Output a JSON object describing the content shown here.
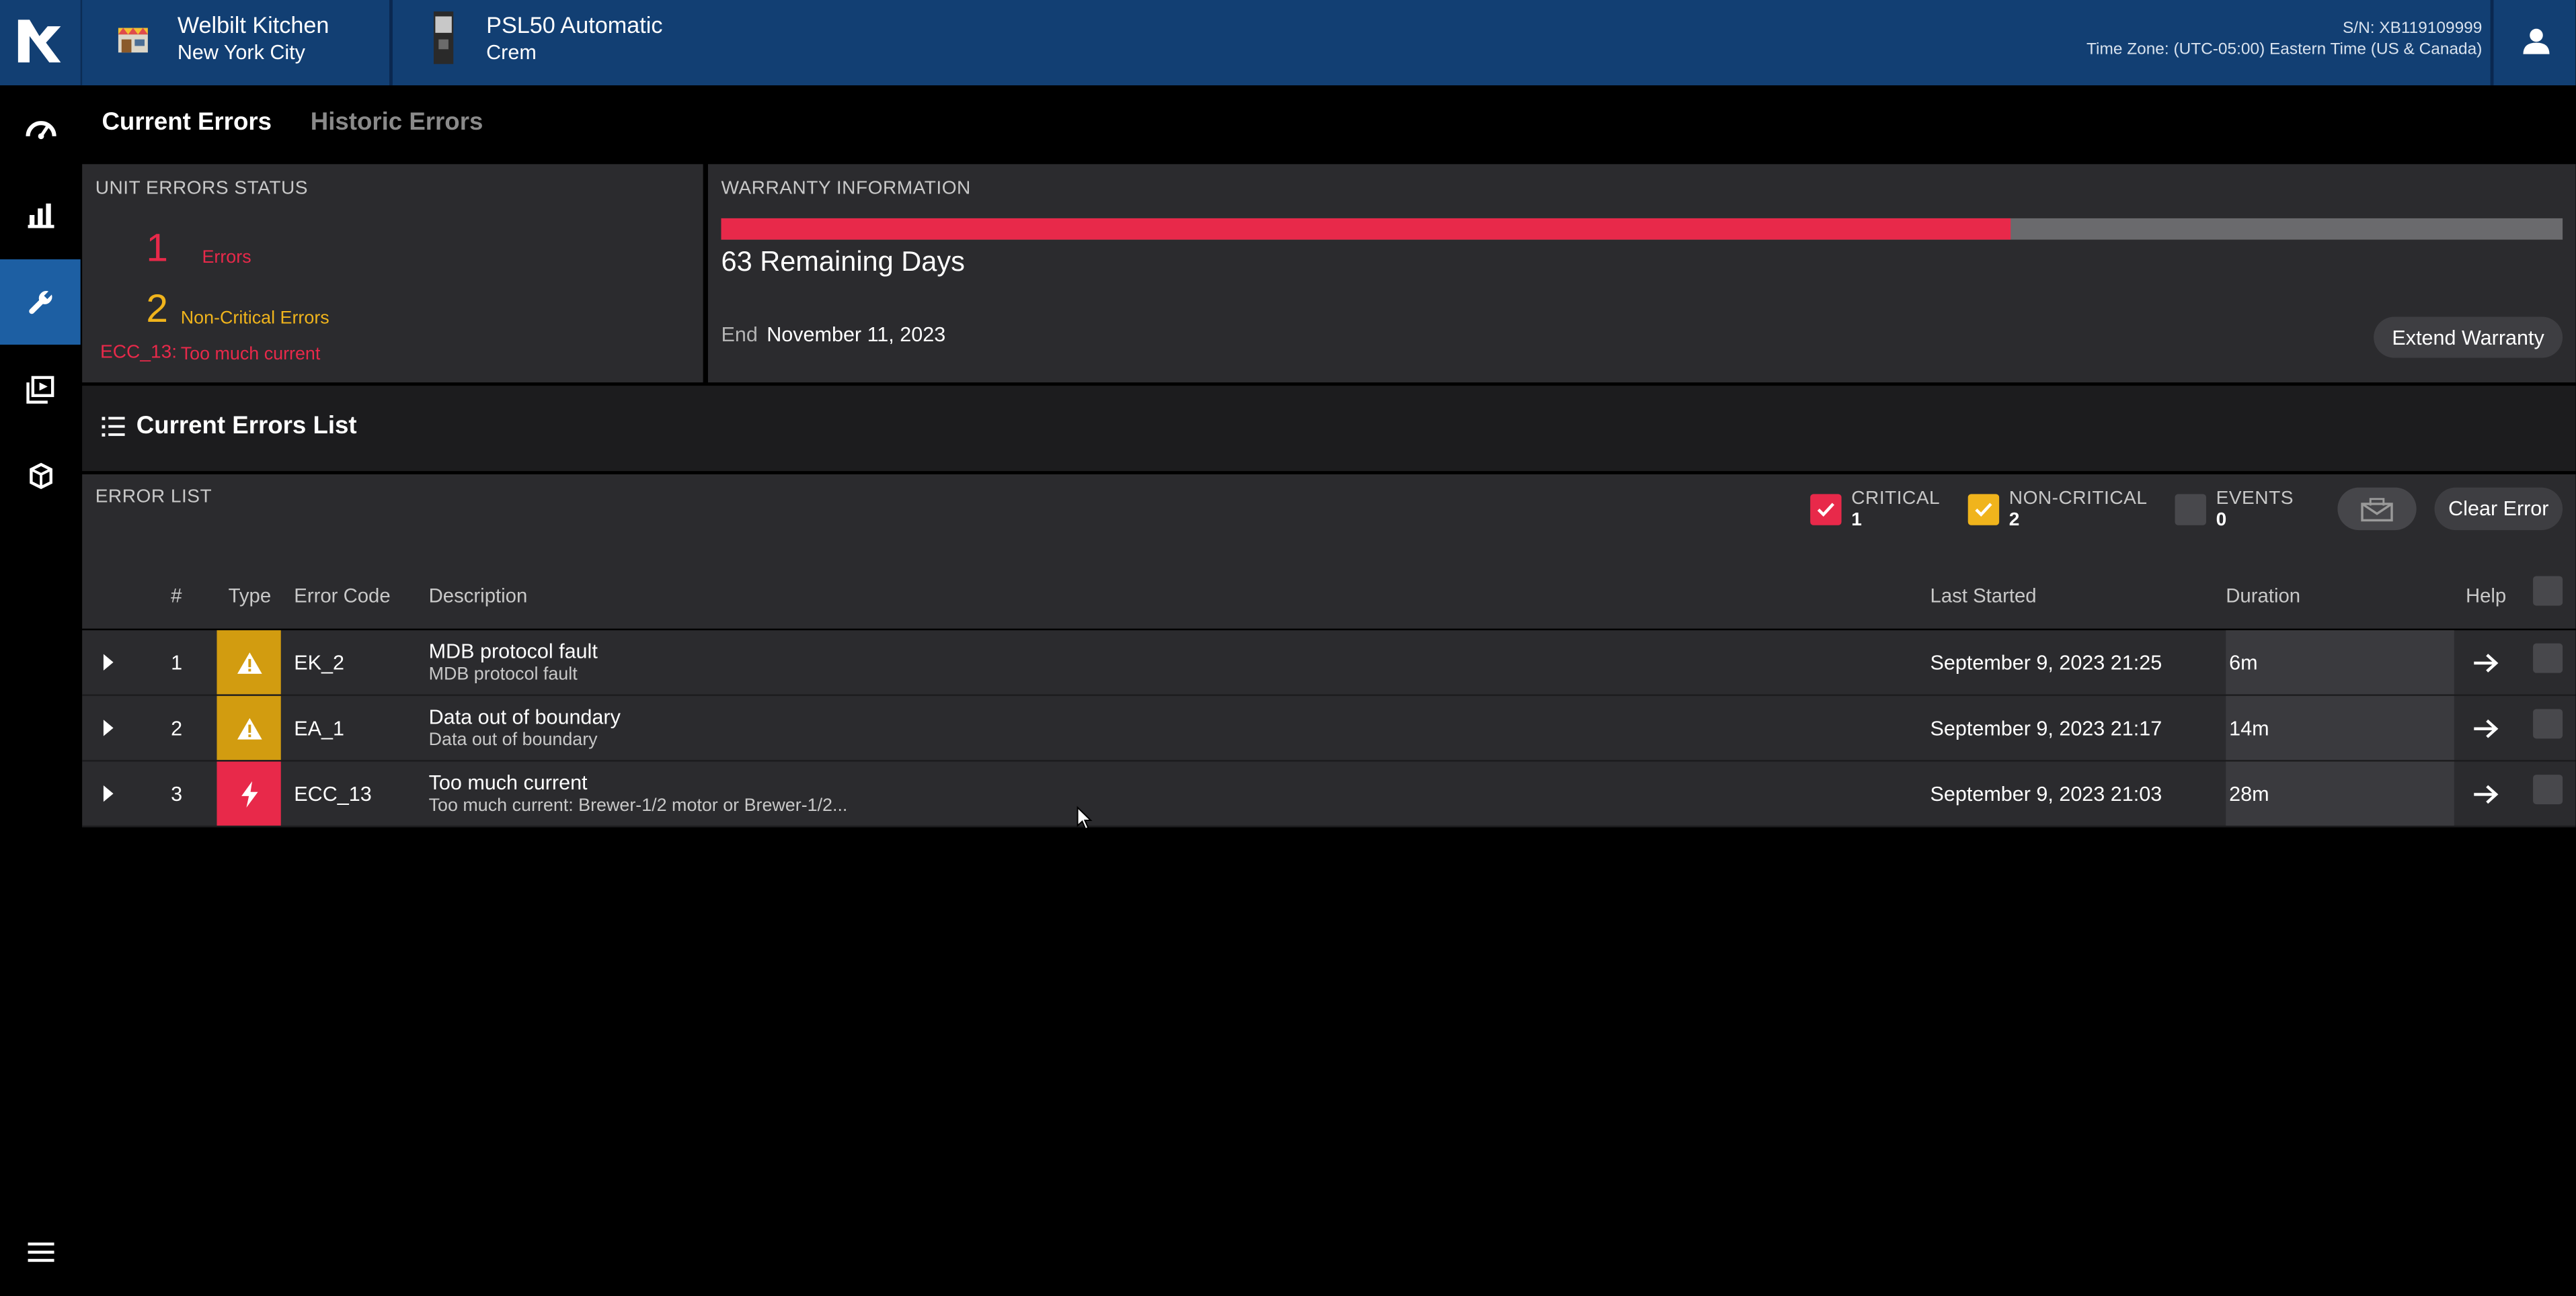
{
  "header": {
    "location_name": "Welbilt Kitchen",
    "location_city": "New York City",
    "unit_model": "PSL50 Automatic",
    "unit_brand": "Crem",
    "serial": "S/N: XB119109999",
    "timezone": "Time Zone: (UTC-05:00) Eastern Time (US & Canada)"
  },
  "tabs": [
    {
      "label": "Current Errors",
      "active": true
    },
    {
      "label": "Historic Errors",
      "active": false
    }
  ],
  "sidebar": {
    "items": [
      {
        "icon": "dashboard-gauge-icon"
      },
      {
        "icon": "bar-chart-icon"
      },
      {
        "icon": "wrench-icon",
        "active": true
      },
      {
        "icon": "media-library-icon"
      },
      {
        "icon": "package-box-icon"
      }
    ],
    "menu_icon": "hamburger-menu-icon"
  },
  "status": {
    "title": "UNIT ERRORS STATUS",
    "errors_count": "1",
    "errors_label": "Errors",
    "noncritical_count": "2",
    "noncritical_label": "Non-Critical Errors",
    "latest_code": "ECC_13:",
    "latest_desc": "Too much current"
  },
  "warranty": {
    "title": "WARRANTY INFORMATION",
    "progress_fraction": 0.7,
    "remaining": "63 Remaining Days",
    "end_label": "End",
    "end_date": "November 11, 2023",
    "extend_label": "Extend Warranty"
  },
  "list_section": {
    "title": "Current Errors List",
    "error_list_label": "ERROR LIST",
    "filters": [
      {
        "label": "CRITICAL",
        "count": "1",
        "checked": true,
        "color": "#e8294a"
      },
      {
        "label": "NON-CRITICAL",
        "count": "2",
        "checked": true,
        "color": "#f0b41c"
      },
      {
        "label": "EVENTS",
        "count": "0",
        "checked": false,
        "color": "#48484c"
      }
    ],
    "clear_label": "Clear Error"
  },
  "table": {
    "columns": {
      "num": "#",
      "type": "Type",
      "code": "Error Code",
      "desc": "Description",
      "started": "Last Started",
      "duration": "Duration",
      "help": "Help"
    },
    "rows": [
      {
        "num": "1",
        "type": "warning",
        "code": "EK_2",
        "title": "MDB protocol fault",
        "detail": "MDB protocol fault",
        "started": "September 9, 2023 21:25",
        "duration": "6m"
      },
      {
        "num": "2",
        "type": "warning",
        "code": "EA_1",
        "title": "Data out of boundary",
        "detail": "Data out of boundary",
        "started": "September 9, 2023 21:17",
        "duration": "14m"
      },
      {
        "num": "3",
        "type": "critical",
        "code": "ECC_13",
        "title": "Too much current",
        "detail": "Too much current: Brewer-1/2 motor or Brewer-1/2...",
        "started": "September 9, 2023 21:03",
        "duration": "28m"
      }
    ]
  },
  "colors": {
    "header_bg": "#123f73",
    "critical": "#e8294a",
    "noncritical": "#f0b41c",
    "warning_cell": "#d29c10",
    "active_nav": "#1d5fa3"
  }
}
